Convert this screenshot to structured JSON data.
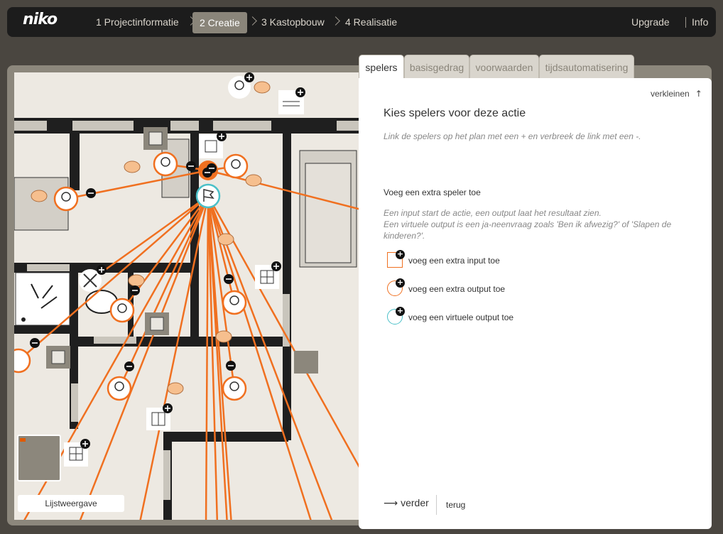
{
  "brand": "niko",
  "steps": [
    {
      "label": "1 Projectinformatie"
    },
    {
      "label": "2 Creatie"
    },
    {
      "label": "3 Kastopbouw"
    },
    {
      "label": "4 Realisatie"
    }
  ],
  "top_links": {
    "upgrade": "Upgrade",
    "info": "Info"
  },
  "tabs": [
    "spelers",
    "basisgedrag",
    "voorwaarden",
    "tijdsautomatisering"
  ],
  "panel": {
    "collapse": "verkleinen",
    "title": "Kies spelers voor deze actie",
    "subtitle": "Link de spelers op het plan met een + en verbreek de link met een -.",
    "add_heading": "Voeg een extra speler toe",
    "explanation_1": "Een input start de actie, een output laat het resultaat zien.",
    "explanation_2": "Een virtuele output is een ja-neenvraag zoals 'Ben ik afwezig?' of 'Slapen de kinderen?'.",
    "options": [
      "voeg een extra input toe",
      "voeg een extra output toe",
      "voeg een virtuele output toe"
    ],
    "next": "verder",
    "back": "terug"
  },
  "list_view_button": "Lijstweergave",
  "colors": {
    "accent": "#f07020",
    "topbar": "#1c1c1c",
    "virtual": "#4ac0c8"
  }
}
